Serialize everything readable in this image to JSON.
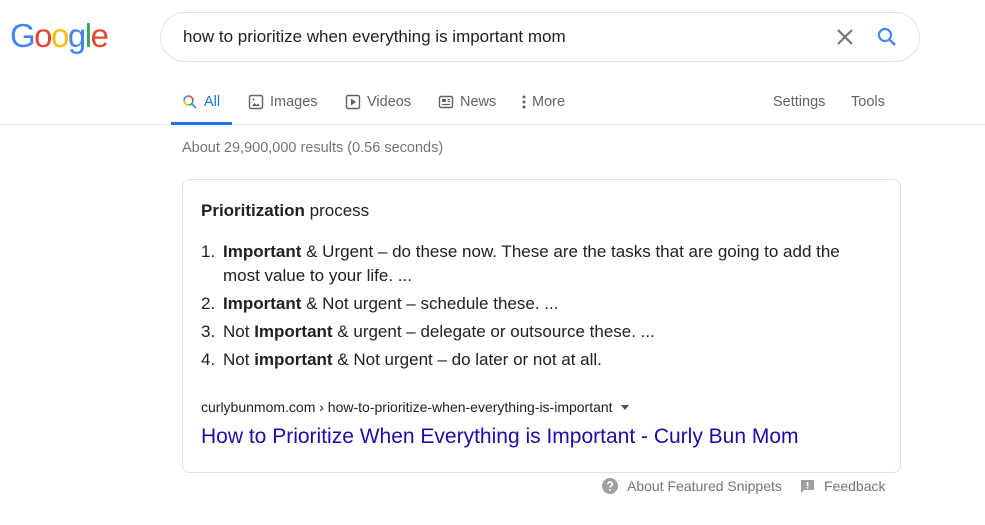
{
  "logo": {
    "letters": [
      {
        "ch": "G",
        "color": "#4285f4"
      },
      {
        "ch": "o",
        "color": "#ea4335"
      },
      {
        "ch": "o",
        "color": "#fbbc05"
      },
      {
        "ch": "g",
        "color": "#4285f4"
      },
      {
        "ch": "l",
        "color": "#34a853"
      },
      {
        "ch": "e",
        "color": "#ea4335"
      }
    ]
  },
  "search": {
    "query": "how to prioritize when everything is important mom",
    "clear_icon": "close-icon",
    "search_icon": "search-icon"
  },
  "tabs": [
    {
      "label": "All",
      "icon": "search-icon",
      "active": true
    },
    {
      "label": "Images",
      "icon": "image-icon",
      "active": false
    },
    {
      "label": "Videos",
      "icon": "play-icon",
      "active": false
    },
    {
      "label": "News",
      "icon": "newspaper-icon",
      "active": false
    },
    {
      "label": "More",
      "icon": "more-vert-icon",
      "active": false
    }
  ],
  "tools": {
    "settings_label": "Settings",
    "tools_label": "Tools"
  },
  "stats": "About 29,900,000 results (0.56 seconds)",
  "snippet": {
    "title_bold": "Prioritization",
    "title_rest": " process",
    "items": [
      {
        "num": "1.",
        "pre": "",
        "bold": "Important",
        "post": " & Urgent – do these now. These are the tasks that are going to add the most value to your life. ..."
      },
      {
        "num": "2.",
        "pre": "",
        "bold": "Important",
        "post": " & Not urgent – schedule these. ..."
      },
      {
        "num": "3.",
        "pre": "Not ",
        "bold": "Important",
        "post": " & urgent – delegate or outsource these. ..."
      },
      {
        "num": "4.",
        "pre": "Not ",
        "bold": "important",
        "post": " & Not urgent – do later or not at all."
      }
    ],
    "cite": "curlybunmom.com › how-to-prioritize-when-everything-is-important",
    "link_title": "How to Prioritize When Everything is Important - Curly Bun Mom"
  },
  "footer": {
    "about_label": "About Featured Snippets",
    "feedback_label": "Feedback"
  },
  "colors": {
    "accent": "#1a73e8",
    "link": "#1a0dab",
    "muted": "#70757a"
  }
}
